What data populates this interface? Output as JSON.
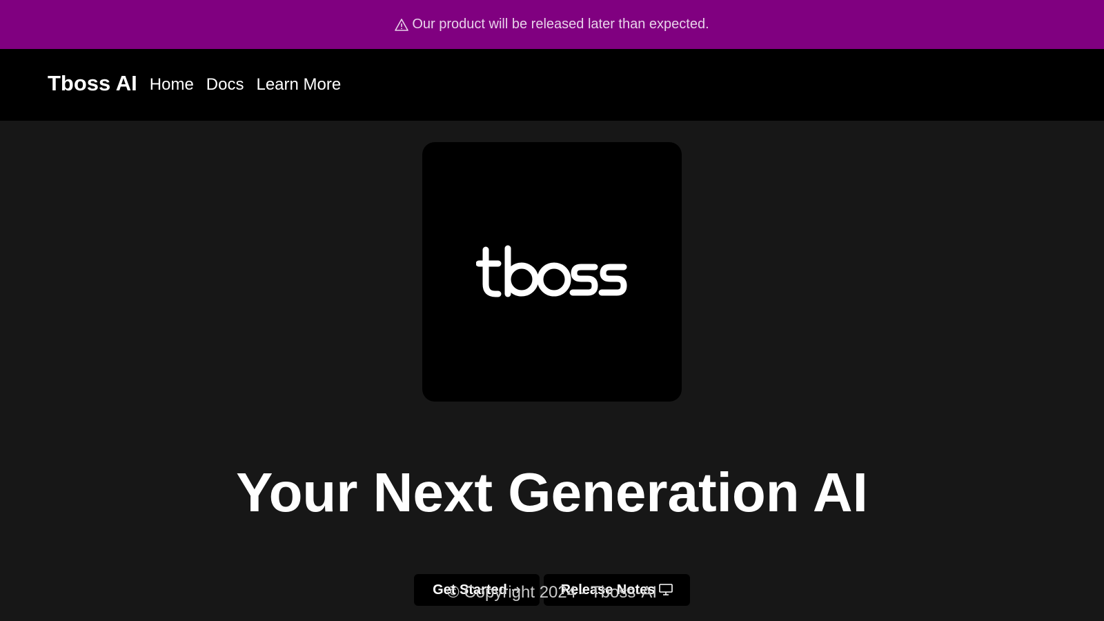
{
  "banner": {
    "icon": "warning-triangle-icon",
    "text": "Our product will be released later than expected.",
    "background": "#800080"
  },
  "navbar": {
    "brand": "Tboss AI",
    "links": [
      "Home",
      "Docs",
      "Learn More"
    ]
  },
  "hero": {
    "logo_text": "tboss",
    "title": "Your Next Generation AI",
    "buttons": {
      "get_started": "Get Started",
      "get_started_icon": "arrow-right-icon",
      "release_notes": "Release Notes",
      "release_notes_icon": "monitor-icon"
    }
  },
  "footer": {
    "copyright": "© Copyright 2024 - Tboss-AI"
  }
}
